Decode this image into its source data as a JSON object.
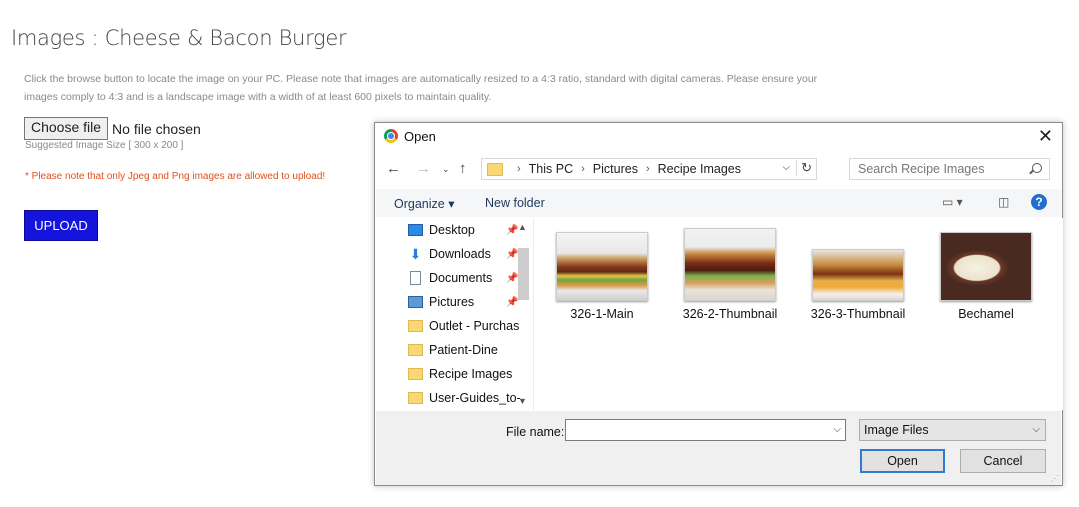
{
  "page": {
    "title": "Images : Cheese & Bacon Burger",
    "instructions": "Click the browse button to locate the image on your PC. Please note that images are automatically resized to a 4:3 ratio, standard with digital cameras. Please ensure your images comply to 4:3 and is a landscape image with a width of at least 600 pixels to maintain quality.",
    "choose_file_label": "Choose file",
    "no_file_text": "No file chosen",
    "suggested_size": "Suggested Image Size [ 300 x 200 ]",
    "format_note": "* Please note that only Jpeg and Png images are allowed to upload!",
    "upload_label": "UPLOAD",
    "upload_color": "#1414dc",
    "note_color": "#e3501c"
  },
  "dialog": {
    "title": "Open",
    "breadcrumb": [
      "This PC",
      "Pictures",
      "Recipe Images"
    ],
    "search_placeholder": "Search Recipe Images",
    "organize_label": "Organize ▾",
    "new_folder_label": "New folder",
    "tree": [
      {
        "label": "Desktop",
        "icon": "desktop-icon",
        "pinned": true
      },
      {
        "label": "Downloads",
        "icon": "downloads-icon",
        "pinned": true
      },
      {
        "label": "Documents",
        "icon": "documents-icon",
        "pinned": true
      },
      {
        "label": "Pictures",
        "icon": "pictures-icon",
        "pinned": true
      },
      {
        "label": "Outlet - Purchas",
        "icon": "folder-icon",
        "pinned": false
      },
      {
        "label": "Patient-Dine",
        "icon": "folder-icon",
        "pinned": false
      },
      {
        "label": "Recipe Images",
        "icon": "folder-icon",
        "pinned": false
      },
      {
        "label": "User-Guides_to-",
        "icon": "folder-icon",
        "pinned": false
      }
    ],
    "files": [
      {
        "label": "326-1-Main"
      },
      {
        "label": "326-2-Thumbnail"
      },
      {
        "label": "326-3-Thumbnail"
      },
      {
        "label": "Bechamel"
      }
    ],
    "file_name_label": "File name:",
    "file_name_value": "",
    "file_type_value": "Image Files",
    "open_label": "Open",
    "cancel_label": "Cancel"
  }
}
